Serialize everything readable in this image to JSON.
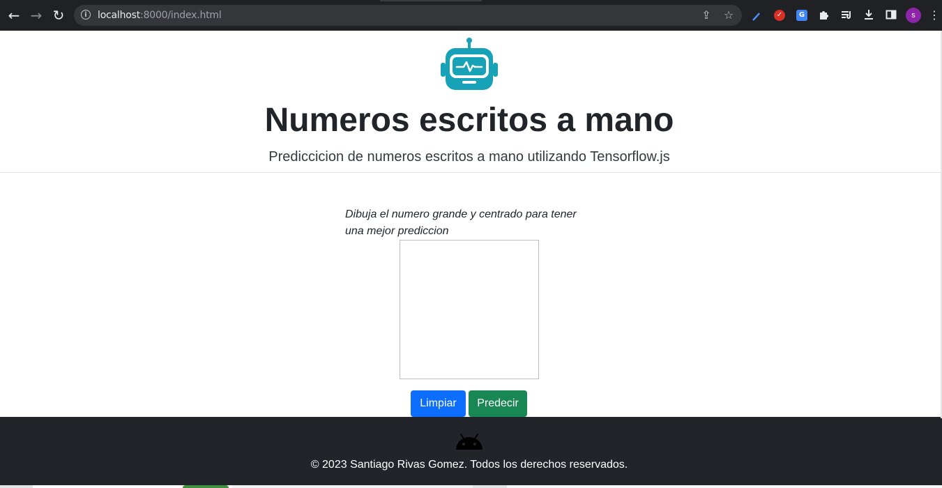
{
  "browser": {
    "url_host": "localhost",
    "url_rest": ":8000/index.html",
    "profile_initial": "s",
    "icons": {
      "back": "back-arrow-icon",
      "forward": "forward-arrow-icon",
      "reload": "reload-icon",
      "site_info": "info-icon",
      "share": "share-icon",
      "bookmark": "star-icon",
      "extensions": [
        "eyedropper-icon",
        "red-extension-icon",
        "translate-icon",
        "puzzle-icon",
        "reading-list-icon",
        "download-icon",
        "side-panel-icon"
      ],
      "menu": "kebab-menu-icon"
    }
  },
  "header": {
    "logo_icon": "robot-icon",
    "logo_color": "#17a2b8",
    "title": "Numeros escritos a mano",
    "subtitle": "Prediccicion de numeros escritos a mano utilizando Tensorflow.js"
  },
  "main": {
    "instructions": "Dibuja el numero grande y centrado para tener una mejor prediccion",
    "clear_button": "Limpiar",
    "predict_button": "Predecir"
  },
  "footer": {
    "icon": "android-icon",
    "copyright": "© 2023 Santiago Rivas Gomez. Todos los derechos reservados."
  },
  "colors": {
    "primary": "#0d6efd",
    "success": "#198754",
    "footer_bg": "#212529"
  }
}
